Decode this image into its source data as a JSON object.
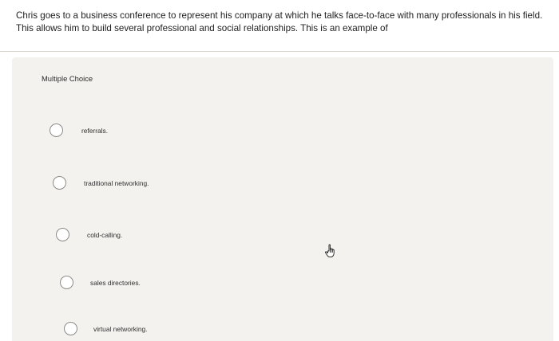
{
  "question": {
    "text": "Chris goes to a business conference to represent his company at which he talks face-to-face with many professionals in his field. This allows him to build several professional and social relationships. This is an example of"
  },
  "question_type": "Multiple Choice",
  "options": [
    {
      "label": "referrals."
    },
    {
      "label": "traditional networking."
    },
    {
      "label": "cold-calling."
    },
    {
      "label": "sales directories."
    },
    {
      "label": "virtual networking."
    }
  ],
  "cursor_icon": "hand-pointer-icon"
}
